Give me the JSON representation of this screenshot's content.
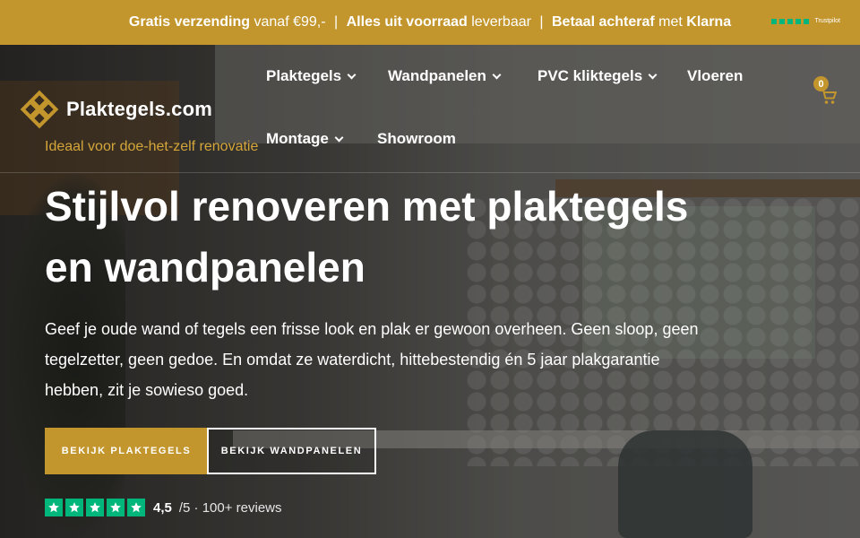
{
  "topbar": {
    "part1_bold": "Gratis verzending",
    "part1_rest": "vanaf €99,-",
    "sep": "|",
    "part2_bold": "Alles uit voorraad",
    "part2_rest": "leverbaar",
    "part3_bold": "Betaal achteraf",
    "part3_rest": "met",
    "part3_brand": "Klarna",
    "trustpilot_label": "Trustpilot"
  },
  "brand": {
    "name": "Plaktegels.com"
  },
  "nav": {
    "items": [
      {
        "label": "Plaktegels"
      },
      {
        "label": "Wandpanelen"
      },
      {
        "label": "PVC kliktegels"
      },
      {
        "label": "Vloeren"
      },
      {
        "label": "Montage"
      },
      {
        "label": "Showroom"
      }
    ]
  },
  "cart": {
    "count": "0"
  },
  "hero": {
    "eyebrow": "Ideaal voor doe-het-zelf renovatie",
    "title": "Stijlvol renoveren met plaktegels en wandpanelen",
    "lead": "Geef je oude wand of tegels een frisse look en plak er gewoon overheen. Geen sloop, geen tegelzetter, geen gedoe. En omdat ze waterdicht, hittebestendig én 5 jaar plakgarantie hebben, zit je sowieso goed.",
    "cta_primary": "Bekijk plaktegels",
    "cta_secondary": "Bekijk wandpanelen"
  },
  "rating": {
    "score": "4,5",
    "rest": "/5 · 100+ reviews",
    "stars": 5
  },
  "colors": {
    "accent": "#c3962d",
    "trustpilot_green": "#00b67a"
  }
}
